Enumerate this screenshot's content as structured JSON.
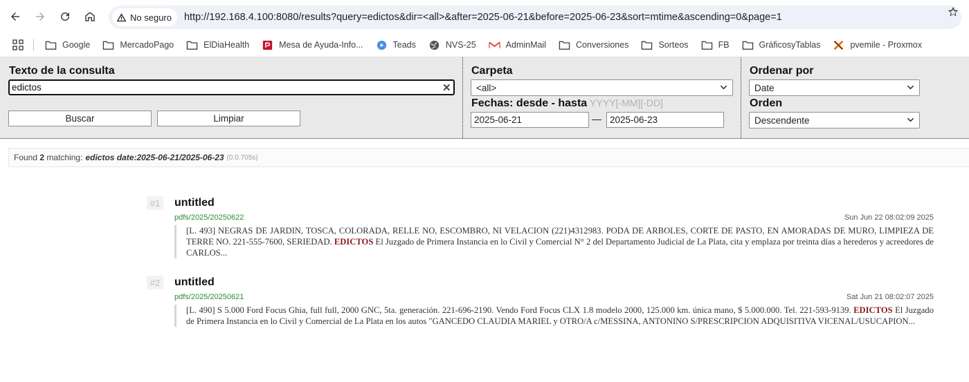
{
  "browser": {
    "security_label": "No seguro",
    "url": "http://192.168.4.100:8080/results?query=edictos&dir=<all>&after=2025-06-21&before=2025-06-23&sort=mtime&ascending=0&page=1",
    "bookmarks": [
      {
        "label": "Google",
        "icon": "folder-icon"
      },
      {
        "label": "MercadoPago",
        "icon": "folder-icon"
      },
      {
        "label": "ElDiaHealth",
        "icon": "folder-icon"
      },
      {
        "label": "Mesa de Ayuda-Info...",
        "icon": "helpdesk-icon"
      },
      {
        "label": "Teads",
        "icon": "teads-icon"
      },
      {
        "label": "NVS-25",
        "icon": "globe-icon"
      },
      {
        "label": "AdminMail",
        "icon": "mail-icon"
      },
      {
        "label": "Conversiones",
        "icon": "folder-icon"
      },
      {
        "label": "Sorteos",
        "icon": "folder-icon"
      },
      {
        "label": "FB",
        "icon": "folder-icon"
      },
      {
        "label": "GráficosyTablas",
        "icon": "folder-icon"
      },
      {
        "label": "pvemile - Proxmox",
        "icon": "proxmox-icon"
      }
    ]
  },
  "form": {
    "query_label": "Texto de la consulta",
    "query_value": "edictos",
    "search_button": "Buscar",
    "clear_button": "Limpiar",
    "folder_label": "Carpeta",
    "folder_value": "<all>",
    "dates_label": "Fechas: desde - hasta",
    "dates_hint": "YYYY[-MM][-DD]",
    "date_from": "2025-06-21",
    "date_separator": "—",
    "date_to": "2025-06-23",
    "sort_label": "Ordenar por",
    "sort_value": "Date",
    "order_label": "Orden",
    "order_value": "Descendente"
  },
  "status": {
    "prefix": "Found",
    "count": "2",
    "suffix": "matching:",
    "query": "edictos date:2025-06-21/2025-06-23",
    "time": "(0.0.705s)"
  },
  "results": [
    {
      "num": "#1",
      "title": "untitled",
      "path": "pdfs/2025/20250622",
      "date": "Sun Jun 22 08:02:09 2025",
      "snippet_before": "[L. 493] NEGRAS DE JARDIN, TOSCA, COLORADA, RELLE NO, ESCOMBRO, NI VELACION (221)4312983. PODA DE ARBOLES, CORTE DE PASTO, EN AMORADAS DE MURO, LIMPIEZA DE TERRE NO. 221-555-7600, SERIEDAD. ",
      "snippet_hl": "EDICTOS",
      "snippet_after": " El Juzgado de Primera Instancia en lo Civil y Comercial N° 2 del Departamento Judicial de La Plata, cita y emplaza por treinta días a herederos y acreedores de CARLOS..."
    },
    {
      "num": "#2",
      "title": "untitled",
      "path": "pdfs/2025/20250621",
      "date": "Sat Jun 21 08:02:07 2025",
      "snippet_before": "[L. 490] S 5.000 Ford Focus Ghia, full full, 2000 GNC, 5ta. generación. 221-696-2190. Vendo Ford Focus CLX 1.8 modelo 2000, 125.000 km. única mano, $ 5.000.000. Tel. 221-593-9139. ",
      "snippet_hl": "EDICTOS",
      "snippet_after": " El Juzgado de Primera Instancia en lo Civil y Comercial de La Plata en los autos \"GANCEDO CLAUDIA MARIEL y OTRO/A c/MESSINA, ANTONINO S/PRESCRIPCION ADQUISITIVA VICENAL/USUCAPION..."
    }
  ]
}
